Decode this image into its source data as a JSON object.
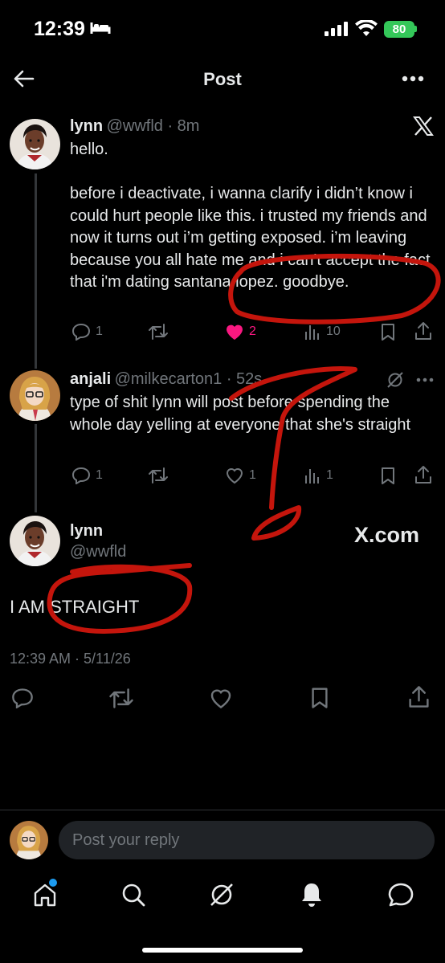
{
  "status_bar": {
    "time": "12:39",
    "battery": "80"
  },
  "header": {
    "title": "Post"
  },
  "post1": {
    "name": "lynn",
    "meta": "@wwfld · 8m",
    "text": "hello.\n\nbefore i deactivate, i wanna clarify i didn’t know i could hurt people like this. i trusted my friends and now it turns out i’m getting exposed. i’m leaving because you all hate me and i can't accept the fact that i'm dating santana lopez. goodbye.",
    "replies": "1",
    "likes": "2",
    "views": "10"
  },
  "reply": {
    "name": "anjali",
    "meta": "@milkecarton1 · 52s",
    "text": "type of shit lynn will post before spending the whole day yelling at everyone that she's straight",
    "replies": "1",
    "likes": "1",
    "views": "1"
  },
  "main": {
    "name": "lynn",
    "handle": "@wwfld",
    "watermark": "X.com",
    "text": "I AM STRAIGHT",
    "timestamp": "12:39 AM · 5/11/26"
  },
  "composer": {
    "placeholder": "Post your reply"
  },
  "colors": {
    "background": "#000000",
    "like": "#f91880",
    "annotation": "#c4150c",
    "unread_dot": "#1d9bf0"
  },
  "icons": [
    "back-arrow-icon",
    "more-icon",
    "x-logo-icon",
    "grok-icon",
    "home-icon",
    "search-icon",
    "notifications-icon",
    "messages-icon"
  ]
}
